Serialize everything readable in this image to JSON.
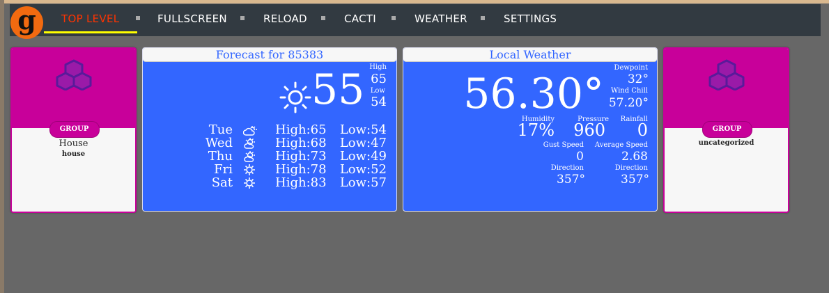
{
  "nav": {
    "logo": "g",
    "items": [
      "TOP LEVEL",
      "FULLSCREEN",
      "RELOAD",
      "CACTI",
      "WEATHER",
      "SETTINGS"
    ]
  },
  "tiles": [
    {
      "badge": "GROUP",
      "name": "House",
      "sub": "house"
    },
    {
      "badge": "GROUP",
      "name": "",
      "sub": "uncategorized"
    }
  ],
  "forecast": {
    "title": "Forecast for 85383",
    "current": "55",
    "high_label": "High",
    "high": "65",
    "low_label": "Low",
    "low": "54",
    "days": [
      {
        "day": "Tue",
        "icon": "partly-cloudy-icon",
        "high": "High:65",
        "low": "Low:54"
      },
      {
        "day": "Wed",
        "icon": "cloud-sun-icon",
        "high": "High:68",
        "low": "Low:47"
      },
      {
        "day": "Thu",
        "icon": "cloud-sun-icon",
        "high": "High:73",
        "low": "Low:49"
      },
      {
        "day": "Fri",
        "icon": "sun-icon",
        "high": "High:78",
        "low": "Low:52"
      },
      {
        "day": "Sat",
        "icon": "sun-icon",
        "high": "High:83",
        "low": "Low:57"
      }
    ]
  },
  "local": {
    "title": "Local Weather",
    "temp": "56.30°",
    "dewpoint_label": "Dewpoint",
    "dewpoint": "32°",
    "windchill_label": "Wind Chill",
    "windchill": "57.20°",
    "humidity_label": "Humidity",
    "humidity": "17%",
    "pressure_label": "Pressure",
    "pressure": "960",
    "rainfall_label": "Rainfall",
    "rainfall": "0",
    "gust_label": "Gust Speed",
    "gust": "0",
    "avg_label": "Average Speed",
    "avg": "2.68",
    "gust_dir_label": "Direction",
    "gust_dir": "357°",
    "avg_dir_label": "Direction",
    "avg_dir": "357°"
  }
}
